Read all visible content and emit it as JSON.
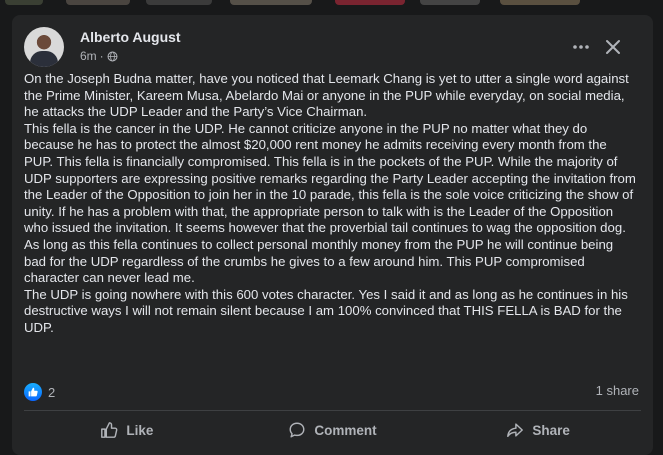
{
  "post": {
    "author": "Alberto August",
    "time": "6m",
    "separator": "·",
    "paragraphs": [
      "On the Joseph Budna matter, have you noticed that Leemark Chang is yet to utter a single word against the Prime Minister, Kareem Musa, Abelardo Mai or anyone in the PUP while everyday,  on social media,  he attacks the UDP Leader and the Party’s Vice Chairman.",
      "This fella is the cancer in the UDP. He cannot criticize anyone in the PUP no matter what they do because he has to protect the almost $20,000 rent money he admits receiving every month from the PUP. This fella is financially compromised. This fella is in the pockets of the PUP. While the majority of UDP supporters are expressing positive remarks regarding the Party Leader accepting the invitation from the Leader of the Opposition to join her in the 10 parade, this fella is the sole voice criticizing the show of unity. If he has a problem with that, the appropriate person to talk with is the Leader of the Opposition who issued the invitation. It seems however that the proverbial tail continues to wag the opposition dog.",
      "As long as this fella continues to collect personal monthly money from the PUP he will continue being bad for the UDP regardless of the crumbs he gives to a few around him. This PUP compromised character can never lead me.",
      "The UDP is going nowhere with this 600 votes character.  Yes I said it and as long as he continues in his destructive ways I will not remain silent because I am 100% convinced that THIS FELLA is BAD for the UDP."
    ]
  },
  "stats": {
    "reaction_count": "2",
    "share_count": "1 share"
  },
  "actions": {
    "like_label": "Like",
    "comment_label": "Comment",
    "share_label": "Share"
  },
  "colors": {
    "background": "#18191a",
    "card": "#242526",
    "text_primary": "#e4e6eb",
    "text_secondary": "#b0b3b8",
    "like_blue": "#1877f2"
  },
  "icons": {
    "globe": "globe-icon",
    "more": "more-options-icon",
    "close": "close-icon",
    "like": "thumbs-up-icon",
    "comment": "comment-bubble-icon",
    "share": "share-arrow-icon"
  }
}
